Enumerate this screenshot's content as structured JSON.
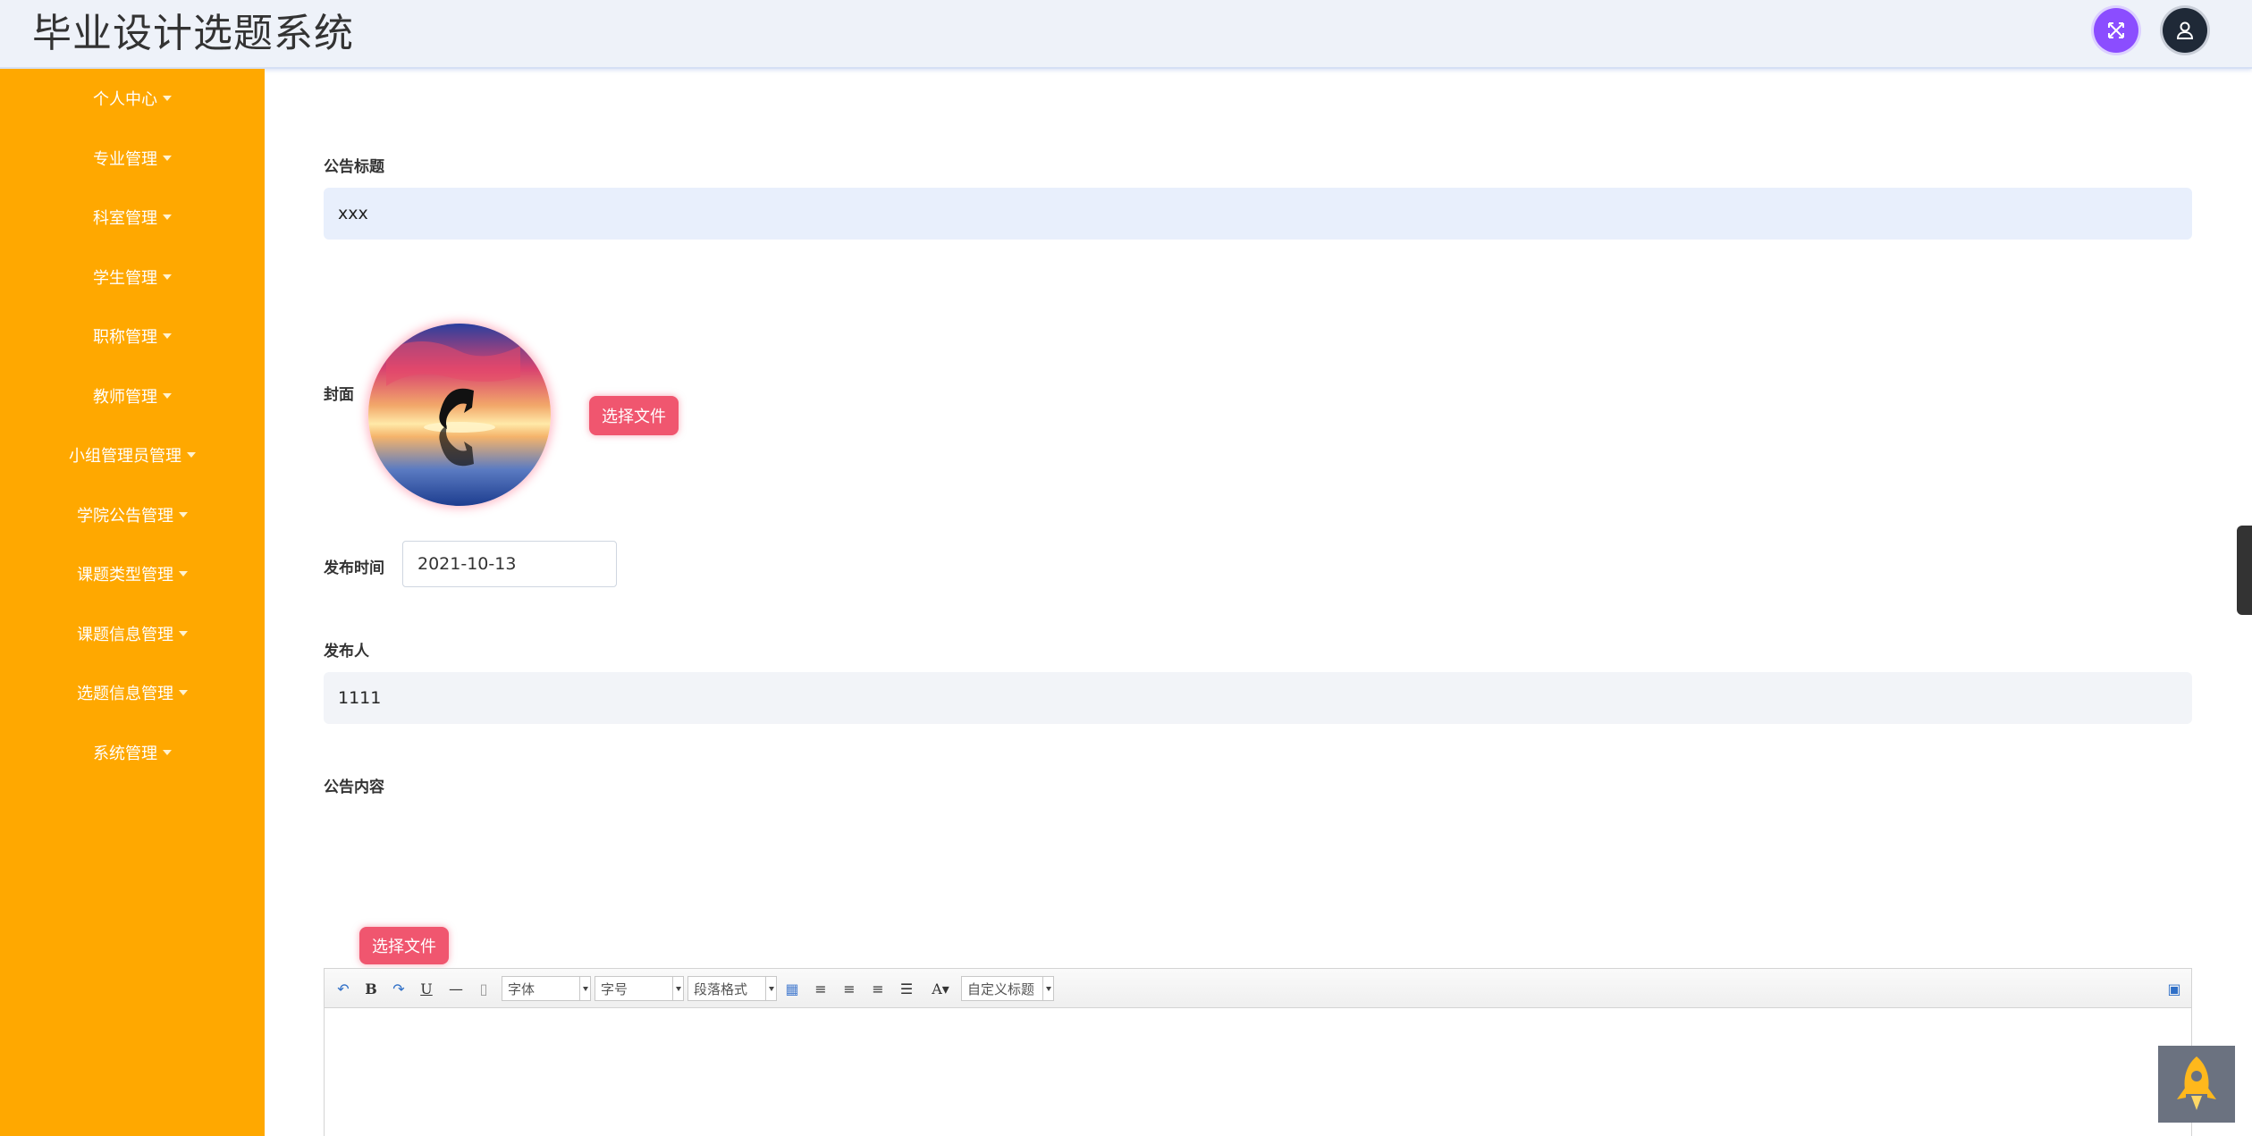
{
  "app": {
    "title": "毕业设计选题系统"
  },
  "header": {
    "fullscreen_icon": "expand-icon",
    "user_icon": "user-icon"
  },
  "sidebar": {
    "items": [
      {
        "label": "个人中心"
      },
      {
        "label": "专业管理"
      },
      {
        "label": "科室管理"
      },
      {
        "label": "学生管理"
      },
      {
        "label": "职称管理"
      },
      {
        "label": "教师管理"
      },
      {
        "label": "小组管理员管理"
      },
      {
        "label": "学院公告管理"
      },
      {
        "label": "课题类型管理"
      },
      {
        "label": "课题信息管理"
      },
      {
        "label": "选题信息管理"
      },
      {
        "label": "系统管理"
      }
    ]
  },
  "form": {
    "title_label": "公告标题",
    "title_value": "xxx",
    "cover_label": "封面",
    "cover_button": "选择文件",
    "publish_time_label": "发布时间",
    "publish_time_value": "2021-10-13",
    "publisher_label": "发布人",
    "publisher_value": "1111",
    "content_label": "公告内容",
    "content_upload_button": "选择文件"
  },
  "editor": {
    "font_family": "字体",
    "font_size": "字号",
    "paragraph": "段落格式",
    "custom_title": "自定义标题"
  },
  "colors": {
    "sidebar": "#ffa800",
    "header": "#eef2f9",
    "accent_pink": "#f0566f",
    "title_input_bg": "#e8effc",
    "publisher_input_bg": "#f2f4f8"
  }
}
